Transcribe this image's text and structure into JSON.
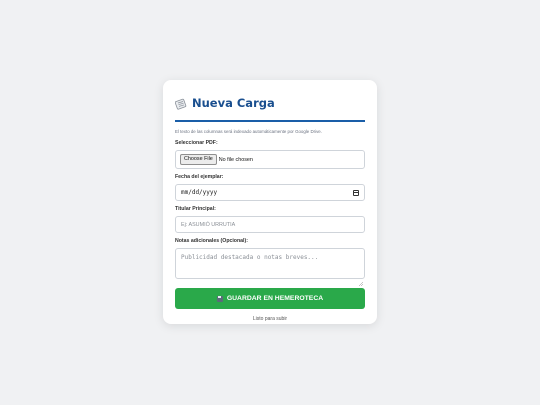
{
  "form": {
    "title": "Nueva Carga",
    "title_icon": "newspaper-icon",
    "hint": "El texto de las columnas será indexado automáticamente por Google Drive.",
    "pdf_label": "Seleccionar PDF:",
    "file_button": "Choose File",
    "file_status": "No file chosen",
    "date_label": "Fecha del ejemplar:",
    "date_placeholder": "mm/dd/yyyy",
    "owner_label": "Titular Principal:",
    "owner_placeholder": "Ej: ASUMIÓ URRUTIA",
    "notes_label": "Notas adicionales (Opcional):",
    "notes_placeholder": "Publicidad destacada o notas breves...",
    "submit_icon": "floppy-disk-icon",
    "submit_label": "GUARDAR EN HEMEROTECA",
    "status": "Listo para subir"
  },
  "colors": {
    "accent": "#1a5ea8",
    "submit": "#2aa94a",
    "background": "#f0f1f3"
  }
}
